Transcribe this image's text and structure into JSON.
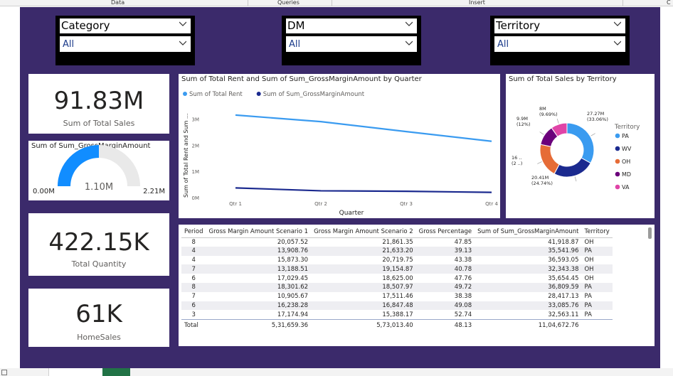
{
  "ribbon": {
    "tabs": [
      "Data",
      "Queries",
      "Insert",
      "C"
    ]
  },
  "slicers": [
    {
      "header": "Category",
      "selected": "All"
    },
    {
      "header": "DM",
      "selected": "All"
    },
    {
      "header": "Territory",
      "selected": "All"
    }
  ],
  "kpis": {
    "total_sales": {
      "value": "91.83M",
      "label": "Sum of Total Sales"
    },
    "total_quantity": {
      "value": "422.15K",
      "label": "Total Quantity"
    },
    "home_sales": {
      "value": "61K",
      "label": "HomeSales"
    }
  },
  "gauge": {
    "title": "Sum of Sum_GrossMarginAmount",
    "value_label": "1.10M",
    "min_label": "0.00M",
    "max_label": "2.21M",
    "fill_fraction": 0.5,
    "fill_color": "#118dff",
    "track_color": "#e9e9e9"
  },
  "line_chart_panel": {
    "title": "Sum of Total Rent and Sum of Sum_GrossMarginAmount by Quarter",
    "ylabel": "Sum of Total Rent and Sum ...",
    "xlabel": "Quarter"
  },
  "donut_panel": {
    "title": "Sum of Total Sales by Territory",
    "legend_title": "Territory"
  },
  "chart_data": [
    {
      "type": "line",
      "title": "Sum of Total Rent and Sum of Sum_GrossMarginAmount by Quarter",
      "xlabel": "Quarter",
      "ylabel": "Sum of Total Rent and Sum ...",
      "categories": [
        "Qtr 1",
        "Qtr 2",
        "Qtr 3",
        "Qtr 4"
      ],
      "y_ticks": [
        "0M",
        "1M",
        "2M",
        "3M"
      ],
      "ylim": [
        0,
        3500000
      ],
      "legend": "top-left",
      "series": [
        {
          "name": "Sum of Total Rent",
          "color": "#3a9bf0",
          "values": [
            3150000,
            2900000,
            2520000,
            2150000
          ]
        },
        {
          "name": "Sum of Sum_GrossMarginAmount",
          "color": "#1b2a8f",
          "values": [
            370000,
            260000,
            240000,
            200000
          ]
        }
      ]
    },
    {
      "type": "pie",
      "title": "Sum of Total Sales by Territory",
      "legend_title": "Territory",
      "legend": "right",
      "slices": [
        {
          "name": "PA",
          "color": "#3a9bf0",
          "value_label": "27.27M",
          "pct_label": "(33.06%)",
          "pct": 33.06
        },
        {
          "name": "WV",
          "color": "#1b2a8f",
          "value_label": "20.41M",
          "pct_label": "(24.74%)",
          "pct": 24.74
        },
        {
          "name": "OH",
          "color": "#e66c37",
          "value_label": "16 ..",
          "pct_label": "(2 ..)",
          "pct": 20.51
        },
        {
          "name": "MD",
          "color": "#6b007b",
          "value_label": "9.9M",
          "pct_label": "(12%)",
          "pct": 12.0
        },
        {
          "name": "VA",
          "color": "#e044a7",
          "value_label": "8M",
          "pct_label": "(9.69%)",
          "pct": 9.69
        }
      ]
    },
    {
      "type": "table",
      "columns": [
        "Period",
        "Gross Margin Amount Scenario 1",
        "Gross Margin Amount Scenario 2",
        "Gross Percentage",
        "Sum of Sum_GrossMarginAmount",
        "Territory"
      ],
      "rows": [
        [
          "8",
          "20,057.52",
          "21,861.35",
          "47.85",
          "41,918.87",
          "OH"
        ],
        [
          "4",
          "13,908.76",
          "21,633.20",
          "39.13",
          "35,541.96",
          "PA"
        ],
        [
          "4",
          "15,873.30",
          "20,719.75",
          "43.38",
          "36,593.05",
          "OH"
        ],
        [
          "7",
          "13,188.51",
          "19,154.87",
          "40.78",
          "32,343.38",
          "OH"
        ],
        [
          "6",
          "17,029.45",
          "18,625.00",
          "47.76",
          "35,654.45",
          "OH"
        ],
        [
          "8",
          "18,301.62",
          "18,507.97",
          "49.72",
          "36,809.59",
          "PA"
        ],
        [
          "7",
          "10,905.67",
          "17,511.46",
          "38.38",
          "28,417.13",
          "PA"
        ],
        [
          "6",
          "16,238.28",
          "16,847.48",
          "49.08",
          "33,085.76",
          "PA"
        ],
        [
          "3",
          "17,174.94",
          "15,388.17",
          "52.74",
          "32,563.11",
          "PA"
        ]
      ],
      "totals": [
        "Total",
        "5,31,659.36",
        "5,73,013.40",
        "48.13",
        "11,04,672.76",
        ""
      ]
    }
  ]
}
